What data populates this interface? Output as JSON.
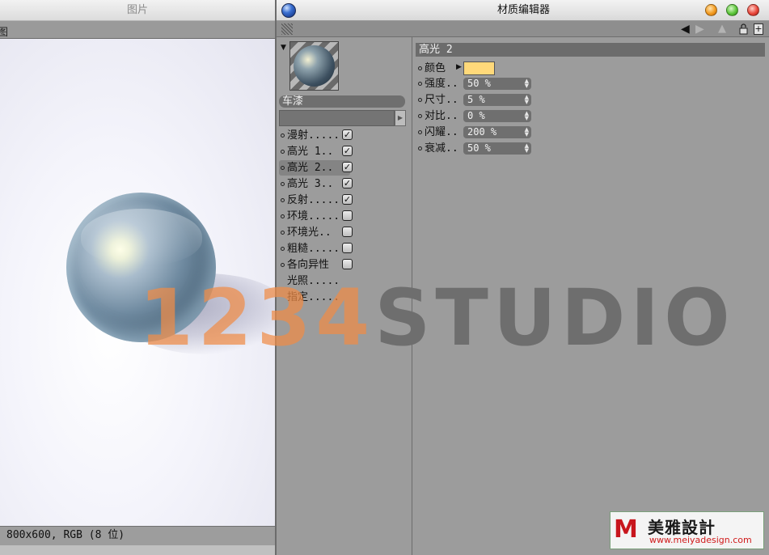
{
  "picture_window": {
    "title": "图片",
    "menu_fragment": "图",
    "status": "800x600, RGB (8 位)"
  },
  "material_editor": {
    "title": "材质编辑器",
    "toolbar": {
      "back_icon": "back-arrow-icon",
      "forward_icon": "forward-arrow-icon",
      "up_icon": "up-arrow-icon",
      "lock_icon": "lock-icon",
      "new_icon": "new-window-icon"
    },
    "material_name": "车漆",
    "channels": [
      {
        "label": "漫射.....",
        "checked": true,
        "has_checkbox": true
      },
      {
        "label": "高光 1..",
        "checked": true,
        "has_checkbox": true
      },
      {
        "label": "高光 2..",
        "checked": true,
        "has_checkbox": true,
        "selected": true
      },
      {
        "label": "高光 3..",
        "checked": true,
        "has_checkbox": true
      },
      {
        "label": "反射.....",
        "checked": true,
        "has_checkbox": true
      },
      {
        "label": "环境.....",
        "checked": false,
        "has_checkbox": true
      },
      {
        "label": "环境光..",
        "checked": false,
        "has_checkbox": true
      },
      {
        "label": "粗糙.....",
        "checked": false,
        "has_checkbox": true
      },
      {
        "label": "各向异性",
        "checked": false,
        "has_checkbox": true
      },
      {
        "label": "光照.....",
        "has_checkbox": false
      },
      {
        "label": "指定.....",
        "has_checkbox": false
      }
    ],
    "section_title": "高光 2",
    "properties": {
      "color": {
        "label": "颜色",
        "value": "#ffd97a"
      },
      "strength": {
        "label": "强度..",
        "value": "50 %"
      },
      "size": {
        "label": "尺寸..",
        "value": "5 %"
      },
      "contrast": {
        "label": "对比..",
        "value": "0 %"
      },
      "glare": {
        "label": "闪耀..",
        "value": "200 %"
      },
      "falloff": {
        "label": "衰减..",
        "value": "50 %"
      }
    }
  },
  "watermark": {
    "number": "1234",
    "word": "STUDIO"
  },
  "logo": {
    "mark": "M",
    "name": "美雅設計",
    "url": "www.meiyadesign.com"
  },
  "colors": {
    "panel": "#9c9c9c",
    "field": "#6f6f6f",
    "highlight_swatch": "#ffd97a",
    "watermark_orange": "#f08c46",
    "watermark_gray": "#6e6e6e"
  }
}
